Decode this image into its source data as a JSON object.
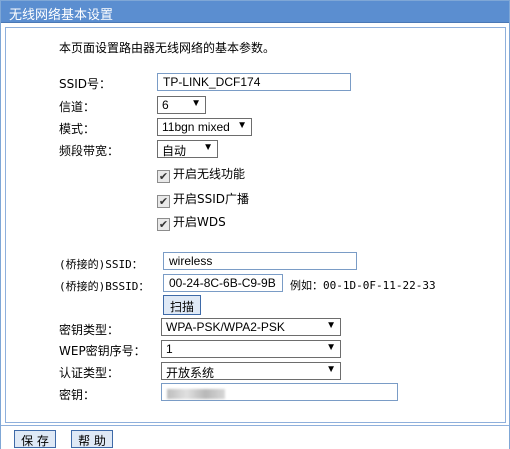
{
  "title": "无线网络基本设置",
  "description": "本页面设置路由器无线网络的基本参数。",
  "fields": {
    "ssid_label": "SSID号：",
    "ssid_value": "TP-LINK_DCF174",
    "channel_label": "信道：",
    "channel_value": "6",
    "mode_label": "模式：",
    "mode_value": "11bgn mixed",
    "bandwidth_label": "频段带宽：",
    "bandwidth_value": "自动"
  },
  "checkboxes": {
    "enable_wireless": "开启无线功能",
    "enable_ssid_broadcast": "开启SSID广播",
    "enable_wds": "开启WDS"
  },
  "wds": {
    "bridged_ssid_label": "(桥接的)SSID：",
    "bridged_ssid_value": "wireless",
    "bridged_bssid_label": "(桥接的)BSSID：",
    "bridged_bssid_value": "00-24-8C-6B-C9-9B",
    "example": "例如：00-1D-0F-11-22-33",
    "scan_button": "扫描",
    "key_type_label": "密钥类型：",
    "key_type_value": "WPA-PSK/WPA2-PSK",
    "wep_index_label": "WEP密钥序号：",
    "wep_index_value": "1",
    "auth_type_label": "认证类型：",
    "auth_type_value": "开放系统",
    "key_label": "密钥："
  },
  "footer": {
    "save": "保 存",
    "help": "帮 助"
  }
}
